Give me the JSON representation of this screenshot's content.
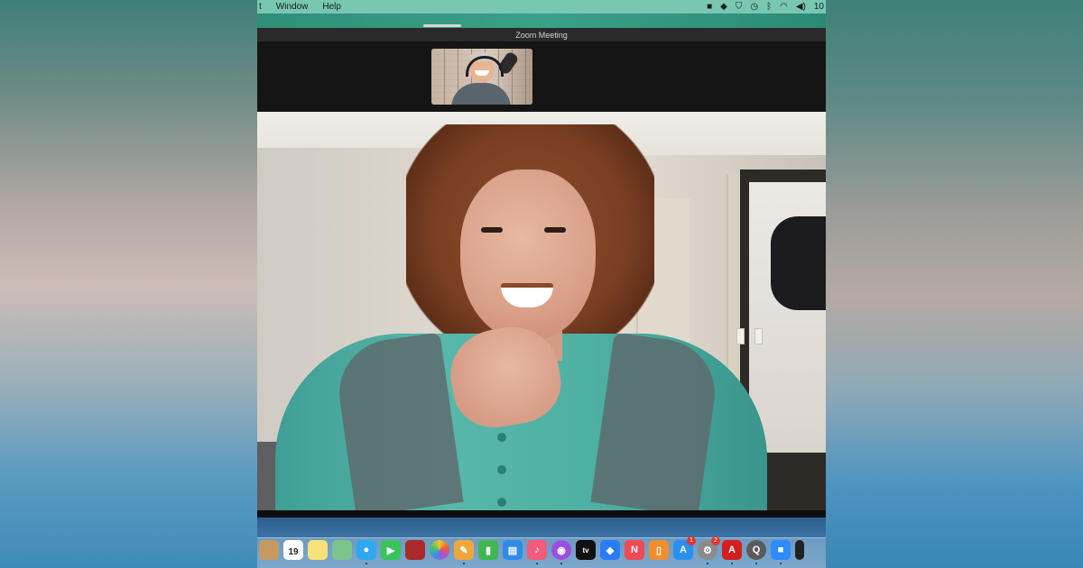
{
  "menubar": {
    "items": [
      "t",
      "Window",
      "Help"
    ],
    "status_icons": [
      "facetime-icon",
      "dropbox-icon",
      "shield-icon",
      "time-machine-icon",
      "bluetooth-icon",
      "wifi-icon",
      "volume-icon"
    ],
    "clock_partial": "10"
  },
  "window": {
    "title": "Zoom Meeting"
  },
  "dock": {
    "calendar_day": "19",
    "icons": [
      {
        "name": "contacts-icon",
        "color": "#c59a62"
      },
      {
        "name": "calendar-icon",
        "color": "#ffffff"
      },
      {
        "name": "notes-icon",
        "color": "#f6e27a"
      },
      {
        "name": "maps-icon",
        "color": "#7cc48c"
      },
      {
        "name": "messages-icon",
        "color": "#2fa8f0"
      },
      {
        "name": "facetime-icon",
        "color": "#37c55a"
      },
      {
        "name": "photo-booth-icon",
        "color": "#a92a2a"
      },
      {
        "name": "photos-icon",
        "color": "#f3f3f3"
      },
      {
        "name": "pages-icon",
        "color": "#f0a73a"
      },
      {
        "name": "numbers-icon",
        "color": "#3fb64f"
      },
      {
        "name": "keynote-icon",
        "color": "#2f8be8"
      },
      {
        "name": "music-icon",
        "color": "#f35a7b"
      },
      {
        "name": "podcasts-icon",
        "color": "#9b4ee0"
      },
      {
        "name": "apple-tv-icon",
        "color": "#111111"
      },
      {
        "name": "dropbox-icon",
        "color": "#2a7cf6"
      },
      {
        "name": "news-icon",
        "color": "#f04a55"
      },
      {
        "name": "books-icon",
        "color": "#f28d2e"
      },
      {
        "name": "app-store-icon",
        "color": "#2b8ff2"
      },
      {
        "name": "system-preferences-icon",
        "color": "#8b8b8b"
      },
      {
        "name": "acrobat-icon",
        "color": "#d31f1f"
      },
      {
        "name": "quicktime-icon",
        "color": "#5a5a5a"
      },
      {
        "name": "zoom-icon",
        "color": "#2d8cff"
      },
      {
        "name": "terminal-icon",
        "color": "#222222"
      }
    ],
    "apple_tv_label": "tv",
    "app_store_badge": "1",
    "system_preferences_badge": "2"
  }
}
